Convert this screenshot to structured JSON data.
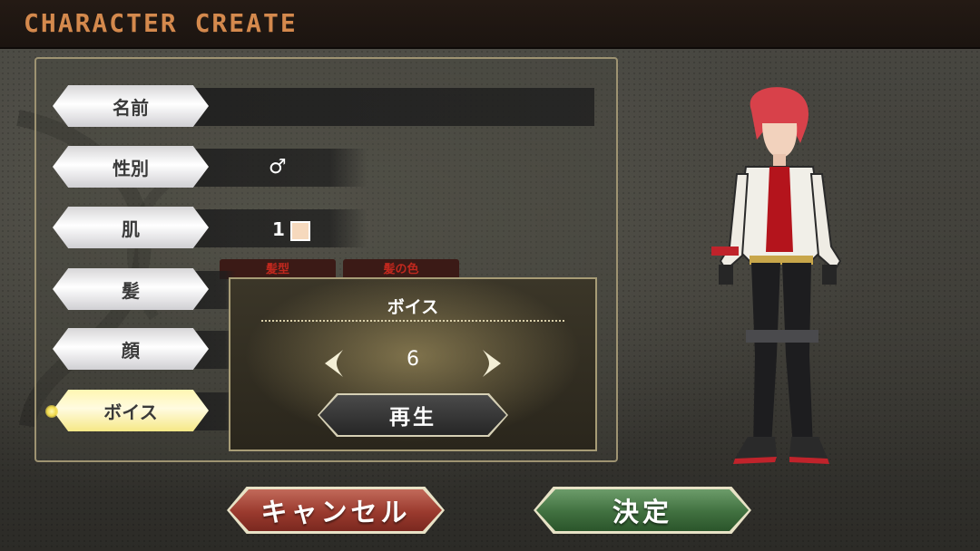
{
  "header": {
    "title": "CHARACTER CREATE"
  },
  "menu": {
    "items": [
      {
        "label": "名前",
        "value": ""
      },
      {
        "label": "性別",
        "value": "♂"
      },
      {
        "label": "肌",
        "value": "1"
      },
      {
        "label": "髪",
        "value": ""
      },
      {
        "label": "顔",
        "value": ""
      },
      {
        "label": "ボイス",
        "value": ""
      }
    ],
    "active_index": 5,
    "hair_tabs": [
      "髪型",
      "髪の色"
    ],
    "skin_swatch_color": "#f6d9bd"
  },
  "voice_popup": {
    "title": "ボイス",
    "value": "6",
    "play_label": "再生"
  },
  "footer": {
    "cancel_label": "キャンセル",
    "confirm_label": "決定"
  },
  "colors": {
    "title_accent": "#d4894d",
    "cancel": "#9a3a2e",
    "confirm": "#40703f",
    "active_item": "#fff6b2"
  }
}
